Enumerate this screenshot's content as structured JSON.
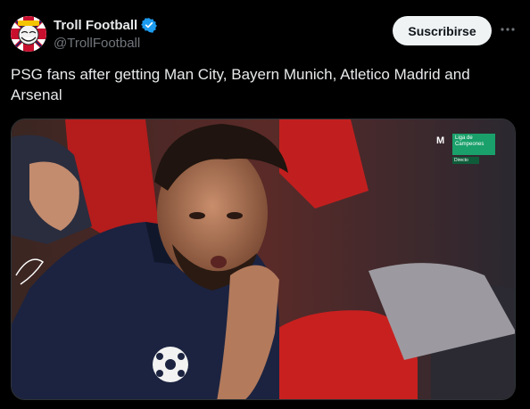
{
  "account": {
    "display_name": "Troll Football",
    "handle": "@TrollFootball",
    "avatar_icon": "troll-face-avatar",
    "verified_color": "#1d9bf0"
  },
  "actions": {
    "subscribe_label": "Suscribirse",
    "more_icon": "more-options-icon"
  },
  "tweet": {
    "text": "PSG fans after getting Man City, Bayern Munich, Atletico Madrid and Arsenal"
  },
  "media": {
    "broadcast_logo": "M",
    "broadcast_title": "Liga de Campeones",
    "broadcast_subtitle": "Directo"
  }
}
